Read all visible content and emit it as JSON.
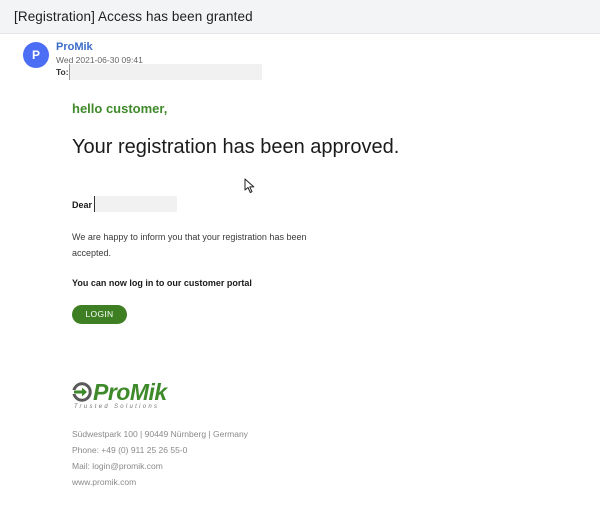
{
  "email": {
    "subject": "[Registration] Access has been granted",
    "sender": {
      "avatar_letter": "P",
      "name": "ProMik",
      "date": "Wed 2021-06-30 09:41",
      "to_label": "To:"
    },
    "body": {
      "greeting": "hello customer,",
      "headline": "Your registration has been approved.",
      "dear_label": "Dear",
      "paragraph": "We are happy to inform you that your registration has been accepted.",
      "portal_line": "You can now log in to our customer portal",
      "login_button": "LOGIN"
    },
    "signature": {
      "logo_word": "ProMik",
      "logo_tagline": "Trusted Solutions",
      "address": "Südwestpark 100 | 90449 Nürnberg | Germany",
      "phone": "Phone: +49 (0) 911 25 26 55-0",
      "mail": "Mail: login@promik.com",
      "web": "www.promik.com"
    }
  },
  "colors": {
    "brand_green": "#3e8a2a",
    "button_green": "#3e7f24",
    "avatar_blue": "#4b6ef5",
    "sender_blue": "#3a6cc9"
  },
  "icons": {
    "cursor": "mouse-pointer-icon",
    "logo_mark": "promik-logo-mark-icon"
  }
}
